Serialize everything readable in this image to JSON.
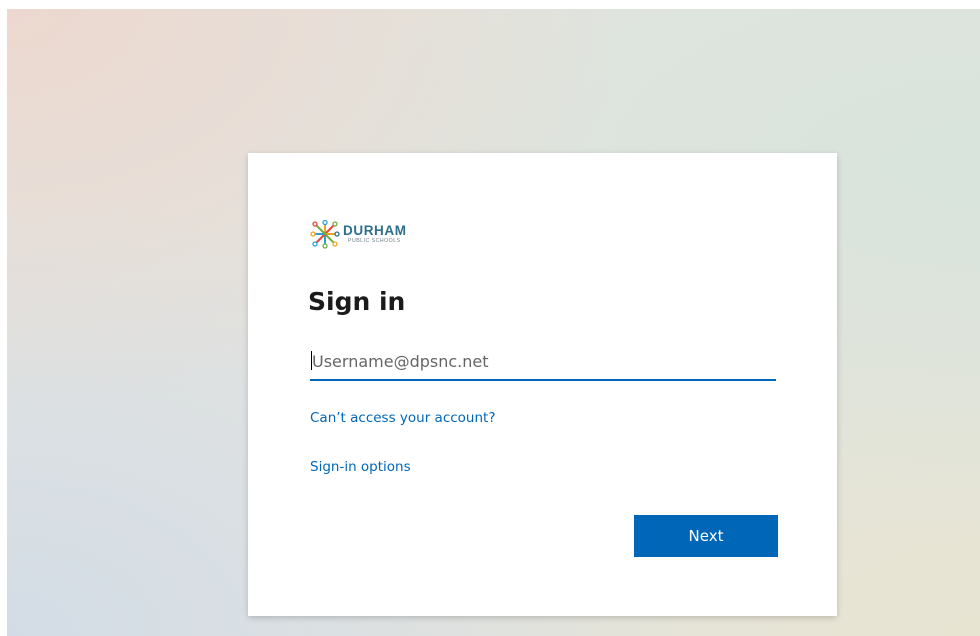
{
  "logo": {
    "title": "DURHAM",
    "subtitle": "PUBLIC SCHOOLS",
    "icon": "durham-public-schools-logo-icon"
  },
  "signin": {
    "title": "Sign in",
    "username_placeholder": "Username@dpsnc.net",
    "username_value": "",
    "cant_access_link": "Can’t access your account?",
    "options_link": "Sign-in options",
    "next_button": "Next"
  },
  "colors": {
    "accent": "#0067b8",
    "logo_text": "#2d6f8c",
    "title_text": "#1b1b1b"
  }
}
